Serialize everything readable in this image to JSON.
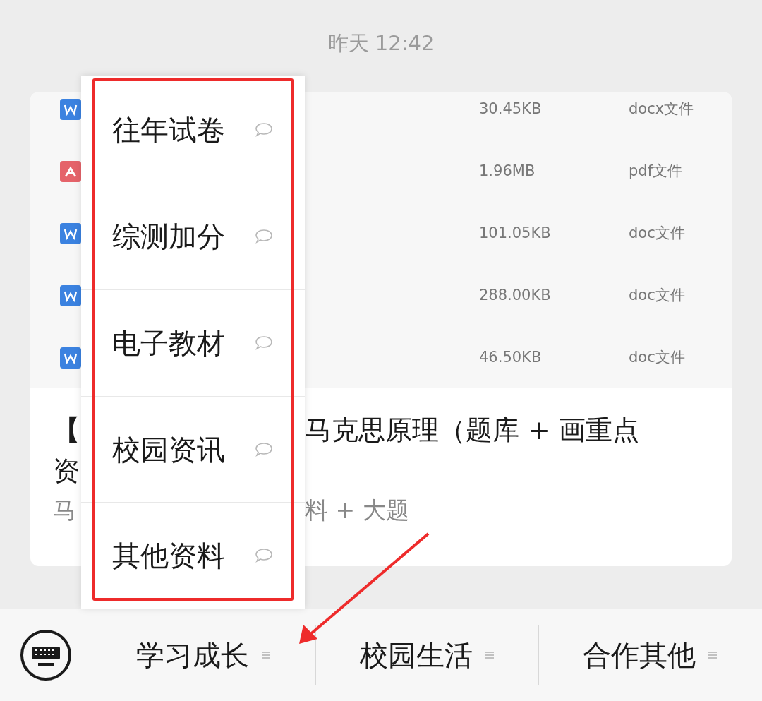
{
  "timestamp": "昨天 12:42",
  "files": [
    {
      "kind": "word",
      "size": "30.45KB",
      "type": "docx文件"
    },
    {
      "kind": "pdf",
      "size": "1.96MB",
      "type": "pdf文件"
    },
    {
      "kind": "word",
      "size": "101.05KB",
      "type": "doc文件"
    },
    {
      "kind": "word",
      "size": "288.00KB",
      "type": "doc文件"
    },
    {
      "kind": "word",
      "size": "46.50KB",
      "type": "doc文件"
    }
  ],
  "article": {
    "title_line1_start": "【",
    "title_line1_end": "马克思原理（题库 + 画重点",
    "title_line2_start": "资",
    "subtitle_start": "马",
    "subtitle_end": "料 + 大题"
  },
  "popup_menu": {
    "items": [
      "往年试卷",
      "综测加分",
      "电子教材",
      "校园资讯",
      "其他资料"
    ]
  },
  "menu_bar": {
    "tabs": [
      {
        "label": "学习成长"
      },
      {
        "label": "校园生活"
      },
      {
        "label": "合作其他"
      }
    ]
  }
}
